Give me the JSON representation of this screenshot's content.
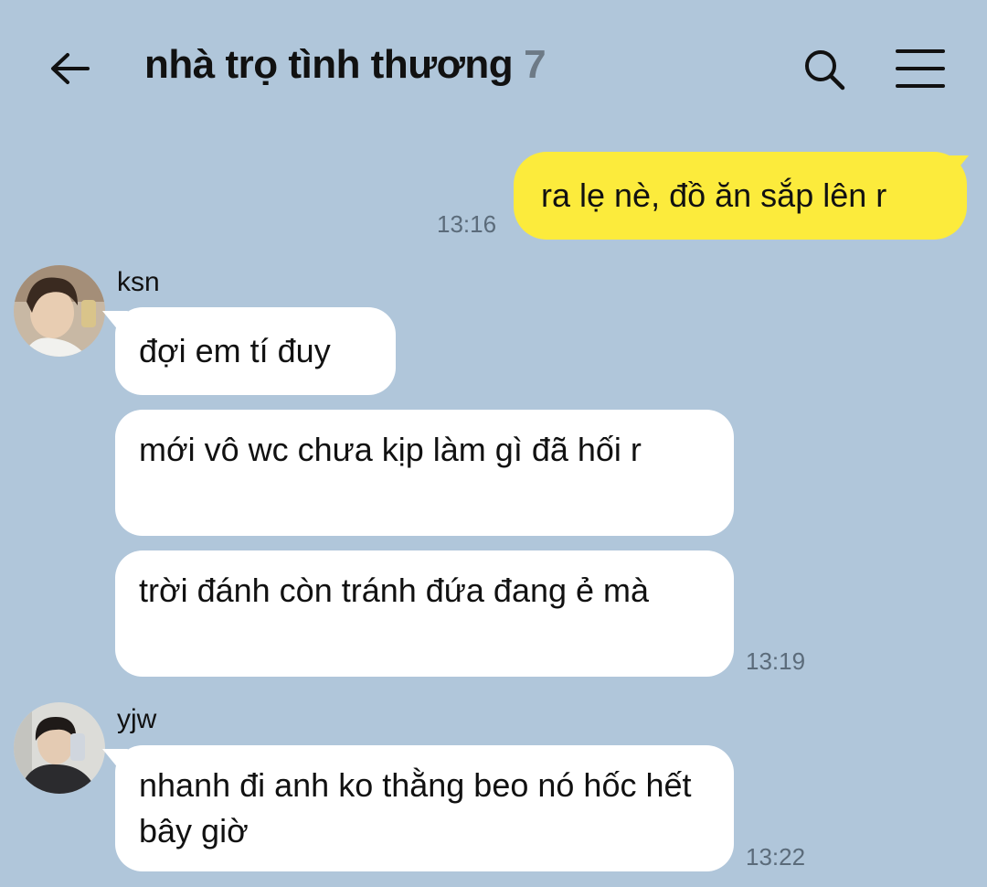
{
  "header": {
    "title": "nhà trọ tình thương",
    "member_count": "7",
    "icons": {
      "back": "back-arrow-icon",
      "search": "search-icon",
      "menu": "menu-icon"
    }
  },
  "colors": {
    "background": "#b0c6da",
    "outgoing_bubble": "#fceb3c",
    "incoming_bubble": "#ffffff",
    "timestamp": "#5b6b7a",
    "count": "#6d7a86"
  },
  "messages": {
    "outgoing": {
      "text": "ra lẹ nè, đồ ăn sắp lên r",
      "time": "13:16"
    },
    "ksn": {
      "sender": "ksn",
      "texts": [
        "đợi em tí đuy",
        "mới vô wc chưa kịp làm gì đã hối r",
        "trời đánh còn tránh đứa đang ẻ mà"
      ],
      "time": "13:19"
    },
    "yjw": {
      "sender": "yjw",
      "texts": [
        "nhanh đi anh ko thằng beo nó hốc hết bây giờ"
      ],
      "time": "13:22"
    }
  }
}
